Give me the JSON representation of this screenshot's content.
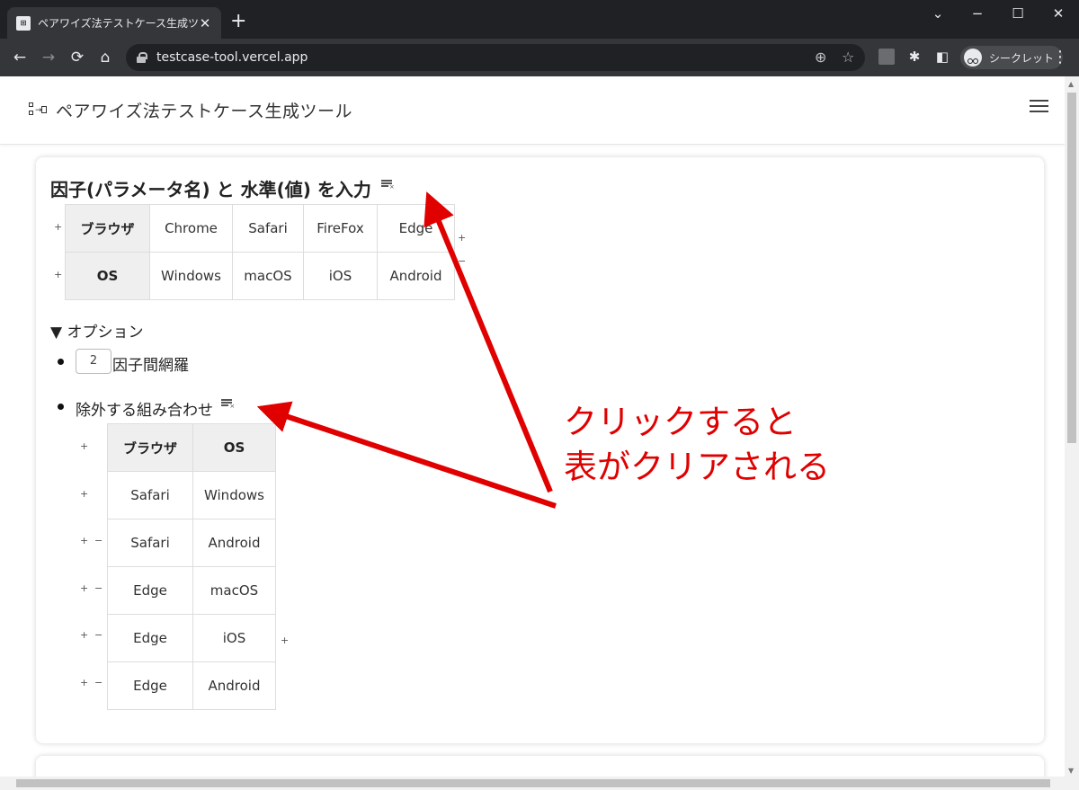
{
  "browser": {
    "tab_title": "ペアワイズ法テストケース生成ツール",
    "tab_favicon": "⊞",
    "tab_close": "✕",
    "new_tab": "+",
    "url": "testcase-tool.vercel.app",
    "profile_label": "シークレット",
    "win_min": "−",
    "win_max": "☐",
    "win_close": "✕",
    "win_chevron": "⌄",
    "back": "←",
    "forward": "→",
    "reload": "⟳",
    "home": "⌂",
    "zoom_icon": "⊕",
    "star_icon": "☆",
    "ext_icon": "✱",
    "panel_icon": "◧",
    "menu": "⋮"
  },
  "app": {
    "title": "ペアワイズ法テストケース生成ツール"
  },
  "factors": {
    "title": "因子(パラメータ名) と 水準(値) を入力",
    "rows": [
      {
        "name": "ブラウザ",
        "values": [
          "Chrome",
          "Safari",
          "FireFox",
          "Edge"
        ]
      },
      {
        "name": "OS",
        "values": [
          "Windows",
          "macOS",
          "iOS",
          "Android"
        ]
      }
    ],
    "add_symbol": "+",
    "remove_symbol": "−"
  },
  "options": {
    "summary": "▼ オプション",
    "coverage_value": "2",
    "coverage_label": "因子間網羅",
    "exclude_label": "除外する組み合わせ",
    "exclude_headers": [
      "ブラウザ",
      "OS"
    ],
    "exclude_rows": [
      [
        "Safari",
        "Windows"
      ],
      [
        "Safari",
        "Android"
      ],
      [
        "Edge",
        "macOS"
      ],
      [
        "Edge",
        "iOS"
      ],
      [
        "Edge",
        "Android"
      ]
    ]
  },
  "annotation": {
    "line1": "クリックすると",
    "line2": "表がクリアされる",
    "color": "#e00000"
  }
}
